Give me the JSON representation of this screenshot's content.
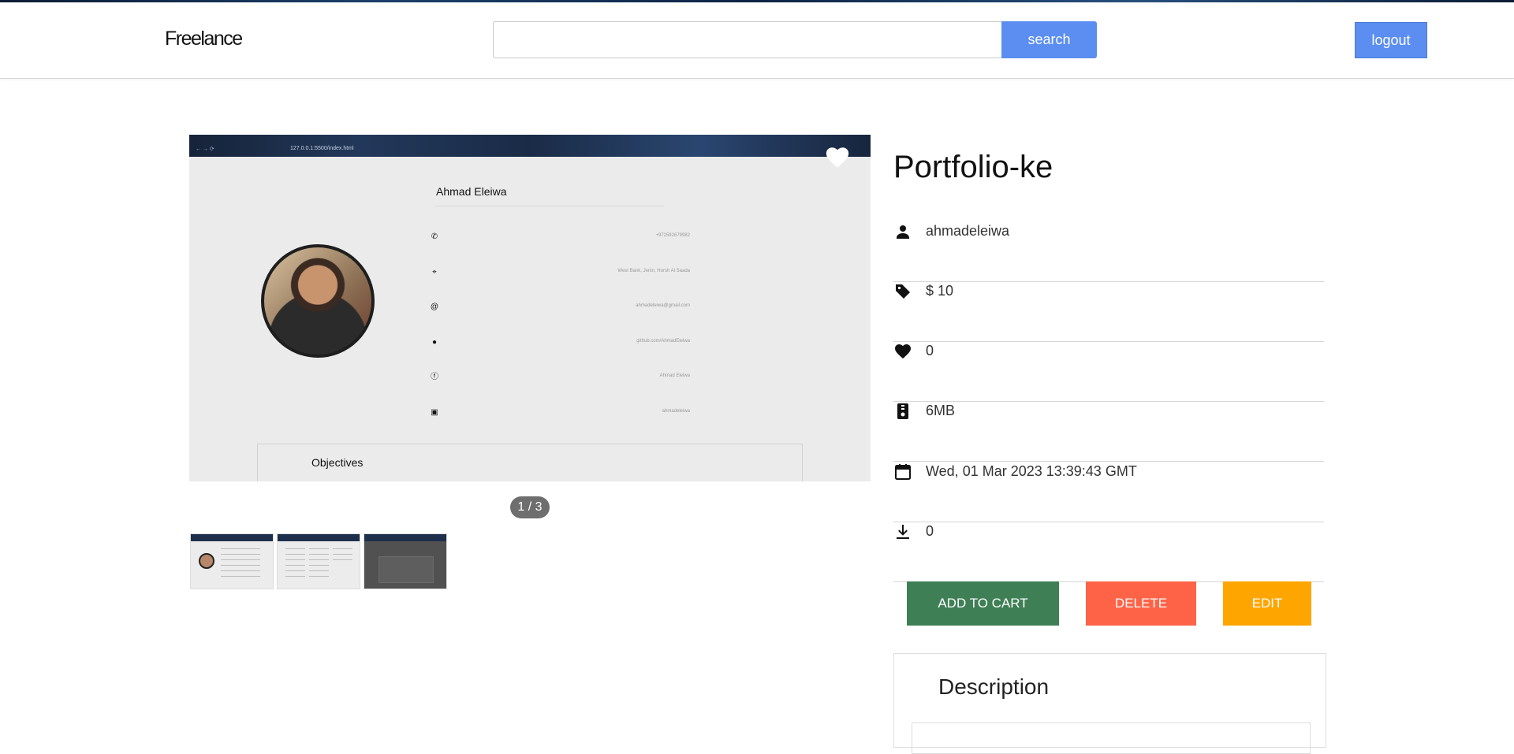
{
  "header": {
    "brand": "Freelance",
    "search": {
      "value": "",
      "placeholder": "",
      "button_label": "search"
    },
    "logout_label": "logout"
  },
  "gallery": {
    "current_slide": 1,
    "total_slides": 3,
    "counter_text": "1 / 3",
    "slide": {
      "browser_url": "127.0.0.1:5500/index.html",
      "person_name": "Ahmad Eleiwa",
      "contacts": [
        {
          "icon": "phone-icon",
          "value": "+972592679982"
        },
        {
          "icon": "location-icon",
          "value": "West Bank, Jenin, Horsh Al Saada"
        },
        {
          "icon": "at-icon",
          "value": "ahmadeleiwa@gmail.com"
        },
        {
          "icon": "github-icon",
          "value": "github.com/AhmadEleiwa"
        },
        {
          "icon": "facebook-icon",
          "value": "Ahmad Eleiwa"
        },
        {
          "icon": "linkedin-icon",
          "value": "ahmadeleiwa"
        }
      ],
      "section_heading": "Objectives"
    },
    "thumbnails": 3
  },
  "product": {
    "title": "Portfolio-ke",
    "author": "ahmadeleiwa",
    "price": "$ 10",
    "likes": "0",
    "size": "6MB",
    "date": "Wed, 01 Mar 2023 13:39:43 GMT",
    "downloads": "0"
  },
  "actions": {
    "add_to_cart": "ADD TO CART",
    "delete": "DELETE",
    "edit": "EDIT"
  },
  "description": {
    "heading": "Description"
  },
  "colors": {
    "primary": "#5b8ef0",
    "cart": "#3f7f55",
    "delete": "#ff6347",
    "edit": "#ffa500"
  }
}
